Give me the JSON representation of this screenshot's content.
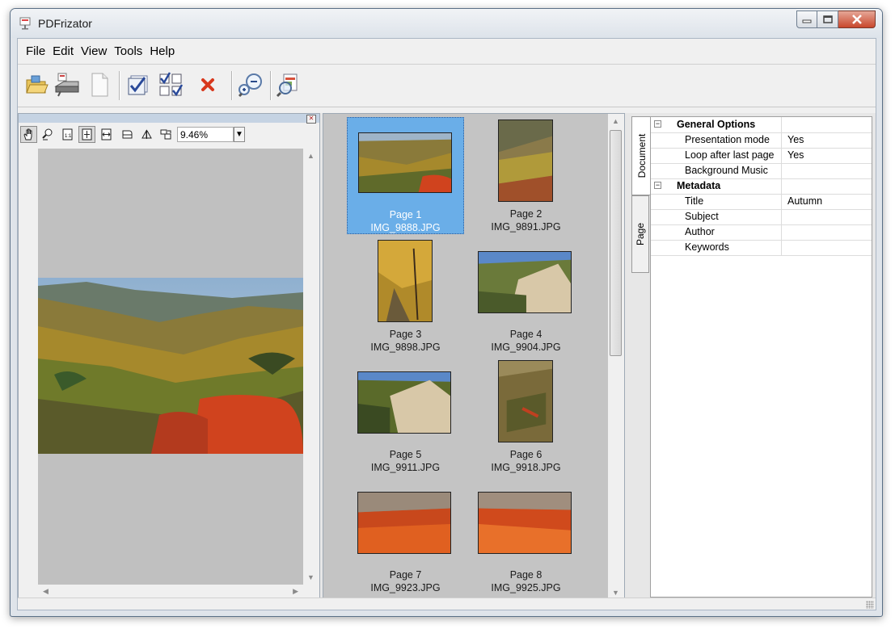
{
  "window": {
    "title": "PDFrizator"
  },
  "menu": [
    "File",
    "Edit",
    "View",
    "Tools",
    "Help"
  ],
  "toolbar": {
    "icons": [
      "open-folder-icon",
      "scanner-icon",
      "new-page-icon",
      "select-all-icon",
      "select-some-icon",
      "delete-icon",
      "zoom-icon",
      "preview-icon"
    ]
  },
  "viewer": {
    "zoom": "9.46%"
  },
  "thumbnails": [
    {
      "page": "Page 1",
      "file": "IMG_9888.JPG"
    },
    {
      "page": "Page 2",
      "file": "IMG_9891.JPG"
    },
    {
      "page": "Page 3",
      "file": "IMG_9898.JPG"
    },
    {
      "page": "Page 4",
      "file": "IMG_9904.JPG"
    },
    {
      "page": "Page 5",
      "file": "IMG_9911.JPG"
    },
    {
      "page": "Page 6",
      "file": "IMG_9918.JPG"
    },
    {
      "page": "Page 7",
      "file": "IMG_9923.JPG"
    },
    {
      "page": "Page 8",
      "file": "IMG_9925.JPG"
    }
  ],
  "tabs": {
    "document": "Document",
    "page": "Page"
  },
  "properties": [
    {
      "key": "General Options",
      "value": "",
      "category": true
    },
    {
      "key": "Presentation mode",
      "value": "Yes"
    },
    {
      "key": "Loop after last page",
      "value": "Yes"
    },
    {
      "key": "Background Music",
      "value": ""
    },
    {
      "key": "Metadata",
      "value": "",
      "category": true
    },
    {
      "key": "Title",
      "value": "Autumn"
    },
    {
      "key": "Subject",
      "value": ""
    },
    {
      "key": "Author",
      "value": ""
    },
    {
      "key": "Keywords",
      "value": ""
    }
  ],
  "colors": {
    "selection": "#6aaee8",
    "thumb_bg": "#c4c4c4",
    "close_button": "#c8472c"
  }
}
